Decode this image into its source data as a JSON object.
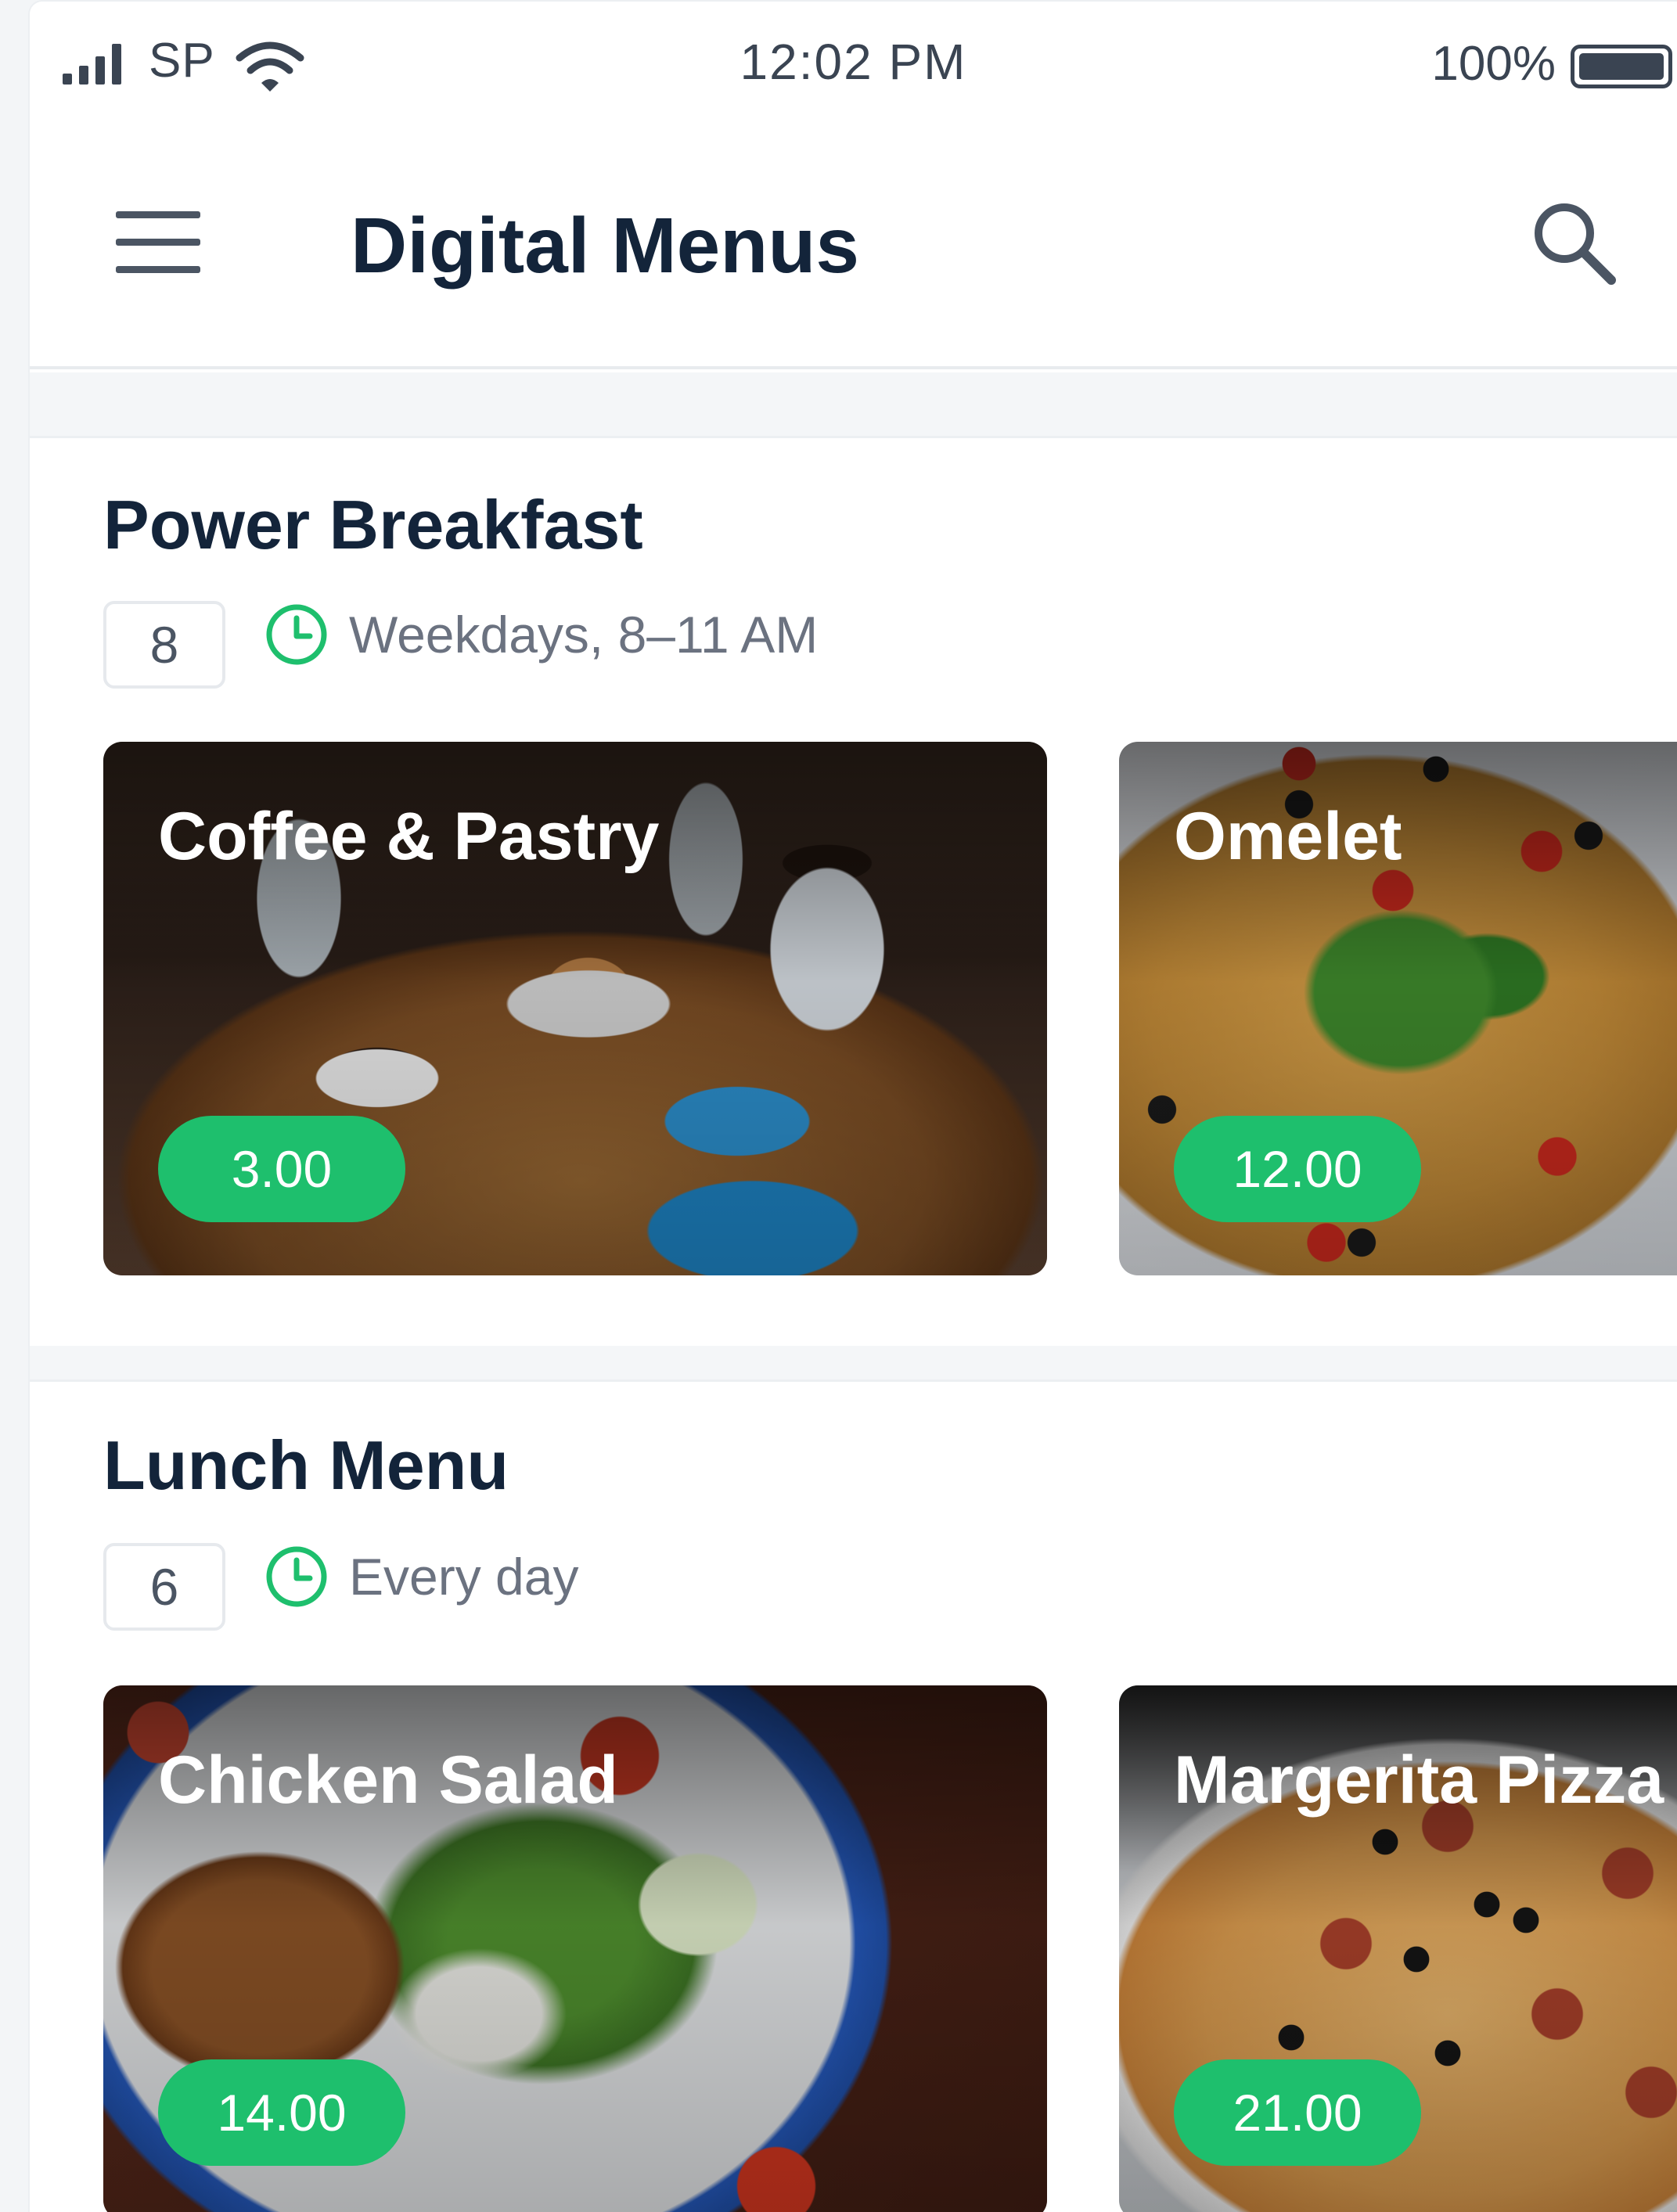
{
  "status_bar": {
    "carrier": "SP",
    "time": "12:02 PM",
    "battery_percent": "100%"
  },
  "header": {
    "title": "Digital Menus",
    "menu_icon": "hamburger-menu-icon",
    "search_icon": "search-icon"
  },
  "sections": [
    {
      "title": "Power Breakfast",
      "count": "8",
      "schedule": "Weekdays, 8–11 AM",
      "items": [
        {
          "name": "Coffee & Pastry",
          "price": "3.00"
        },
        {
          "name": "Omelet",
          "price": "12.00"
        }
      ]
    },
    {
      "title": "Lunch Menu",
      "count": "6",
      "schedule": "Every day",
      "items": [
        {
          "name": "Chicken Salad",
          "price": "14.00"
        },
        {
          "name": "Margerita Pizza",
          "price": "21.00"
        }
      ]
    }
  ],
  "colors": {
    "accent_green": "#1ebf6d",
    "title_navy": "#13243a",
    "muted_gray": "#6b7280"
  }
}
